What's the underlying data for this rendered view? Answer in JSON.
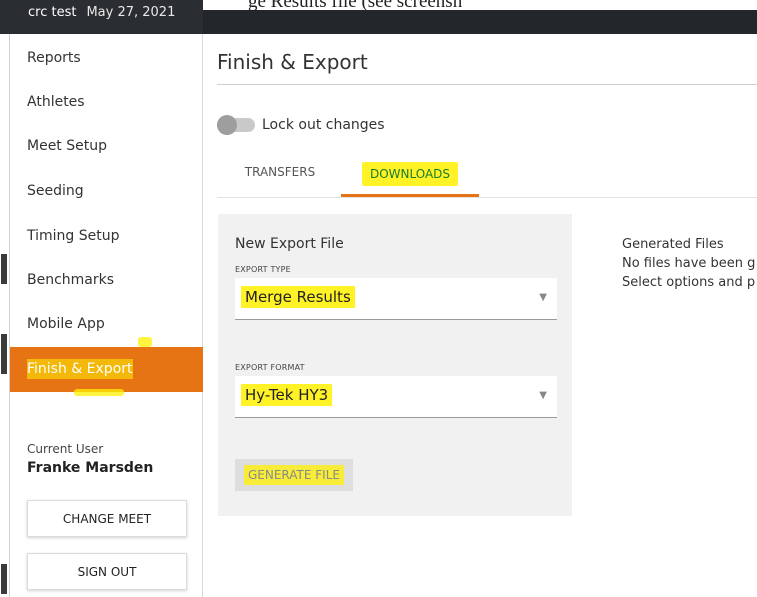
{
  "header": {
    "meet_name": "crc test",
    "meet_date": "May 27, 2021",
    "cropped_caption": "ge Results file (see screensh"
  },
  "sidebar": {
    "items": [
      {
        "label": "Reports"
      },
      {
        "label": "Athletes"
      },
      {
        "label": "Meet Setup"
      },
      {
        "label": "Seeding"
      },
      {
        "label": "Timing Setup"
      },
      {
        "label": "Benchmarks"
      },
      {
        "label": "Mobile App"
      },
      {
        "label": "Finish & Export"
      }
    ],
    "active_item": "Finish & Export",
    "current_user_label": "Current User",
    "current_user_name": "Franke Marsden",
    "change_meet_label": "CHANGE MEET",
    "sign_out_label": "SIGN OUT"
  },
  "main": {
    "title": "Finish & Export",
    "lock_label": "Lock out changes",
    "lock_enabled": false,
    "tabs": [
      {
        "label": "TRANSFERS"
      },
      {
        "label": "DOWNLOADS"
      }
    ],
    "active_tab": "DOWNLOADS",
    "export": {
      "title": "New Export File",
      "type_label": "EXPORT TYPE",
      "type_value": "Merge Results",
      "format_label": "EXPORT FORMAT",
      "format_value": "Hy-Tek HY3",
      "generate_label": "GENERATE FILE"
    },
    "generated": {
      "title": "Generated Files",
      "line1": "No files have been g",
      "line2": "Select options and p"
    }
  },
  "colors": {
    "accent": "#e67415",
    "highlight": "#fff000",
    "active_tab_text": "#1a7d2a",
    "topbar": "#2a2d31"
  }
}
